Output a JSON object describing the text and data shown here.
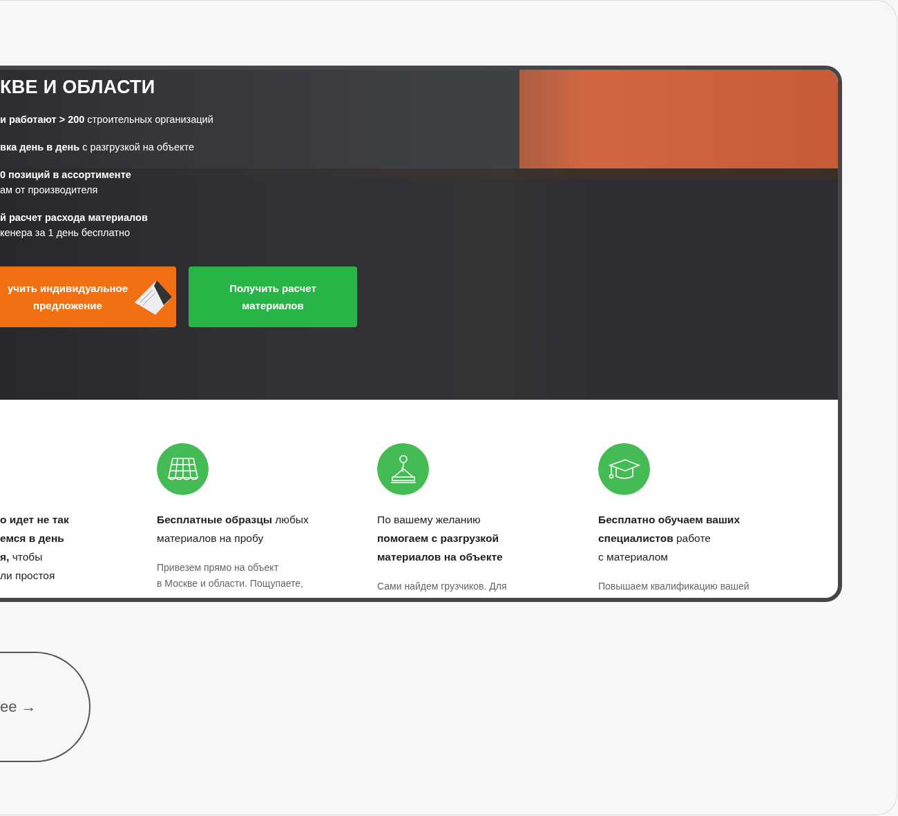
{
  "hero": {
    "title": "КВЕ И ОБЛАСТИ",
    "bullets": [
      {
        "lines": [
          "**и работают > 200** строительных организаций"
        ]
      },
      {
        "lines": [
          "**вка день в день** с разгрузкой на объекте"
        ]
      },
      {
        "lines": [
          "**0 позиций в ассортименте**",
          "ам от производителя"
        ]
      },
      {
        "lines": [
          "**й расчет расхода материалов**",
          "кенера за 1 день бесплатно"
        ]
      }
    ],
    "buttons": [
      {
        "kind": "offer",
        "lines": [
          "учить индивидуальное",
          "предложение"
        ]
      },
      {
        "kind": "calc",
        "lines": [
          "Получить расчет",
          "материалов"
        ]
      }
    ]
  },
  "features": [
    {
      "kind": "plain",
      "heading": [
        "**о идет не так**",
        "**емся в день**",
        "**я,** чтобы",
        "ли простоя"
      ]
    },
    {
      "kind": "tiles",
      "heading": [
        "**Бесплатные образцы** любых",
        "материалов на пробу"
      ],
      "text": [
        "Привезем прямо на объект",
        "в Москве и области. Пощупаете,"
      ]
    },
    {
      "kind": "crane",
      "heading": [
        "По вашему желанию",
        "**помогаем с разгрузкой**",
        "**материалов на объекте**"
      ],
      "text": [
        "Сами найдем грузчиков. Для"
      ]
    },
    {
      "kind": "cap",
      "heading": [
        "**Бесплатно обучаем ваших**",
        "**специалистов** работе",
        "с материалом"
      ],
      "text": [
        "Повышаем квалификацию вашей"
      ]
    }
  ],
  "more_button": "ee →"
}
